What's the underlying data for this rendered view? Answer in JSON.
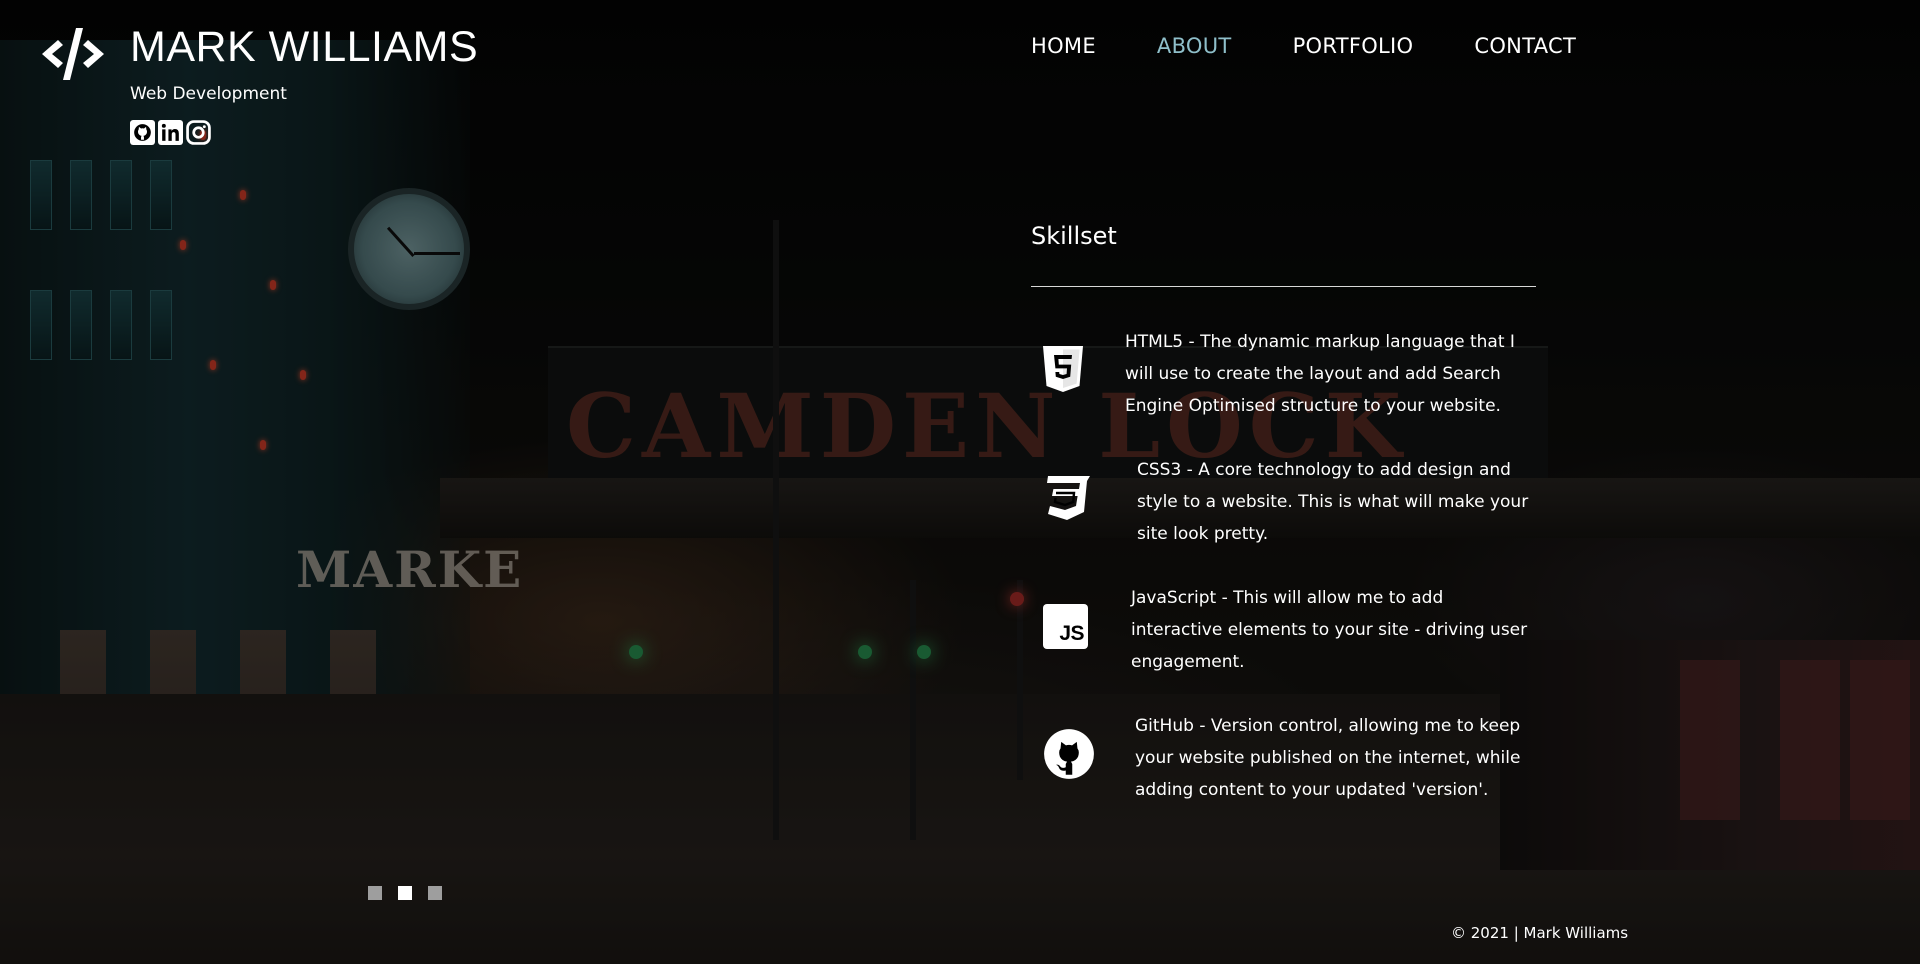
{
  "brand": {
    "name": "MARK WILLIAMS",
    "subtitle": "Web Development",
    "logo_icon": "code-slash-icon",
    "social": [
      {
        "name": "github",
        "icon": "github-icon"
      },
      {
        "name": "linkedin",
        "icon": "linkedin-icon"
      },
      {
        "name": "instagram",
        "icon": "instagram-icon"
      }
    ]
  },
  "nav": {
    "items": [
      {
        "label": "HOME",
        "active": false
      },
      {
        "label": "ABOUT",
        "active": true
      },
      {
        "label": "PORTFOLIO",
        "active": false
      },
      {
        "label": "CONTACT",
        "active": false
      }
    ],
    "active_color": "#8fbfca"
  },
  "skillset": {
    "title": "Skillset",
    "skills": [
      {
        "icon": "html5-icon",
        "lines": [
          "HTML5 - The dynamic markup language that I",
          "will use to create the layout and add Search",
          "Engine Optimised structure to your website."
        ]
      },
      {
        "icon": "css3-icon",
        "lines": [
          "CSS3 - A core technology to add design and",
          "style to a website. This is what will make your",
          "site look pretty."
        ]
      },
      {
        "icon": "javascript-icon",
        "icon_text": "JS",
        "lines": [
          "JavaScript - This will allow me to add",
          "interactive elements to your site - driving user",
          "engagement."
        ]
      },
      {
        "icon": "github-icon",
        "lines": [
          "GitHub - Version control, allowing me to keep",
          "your website published on the internet, while",
          "adding content to your updated 'version'."
        ]
      }
    ]
  },
  "slider": {
    "count": 3,
    "active_index": 1
  },
  "background": {
    "sign_text": "CAMDEN LOCK",
    "market_text": "MARKE"
  },
  "footer": {
    "text": "© 2021 | Mark Williams"
  }
}
